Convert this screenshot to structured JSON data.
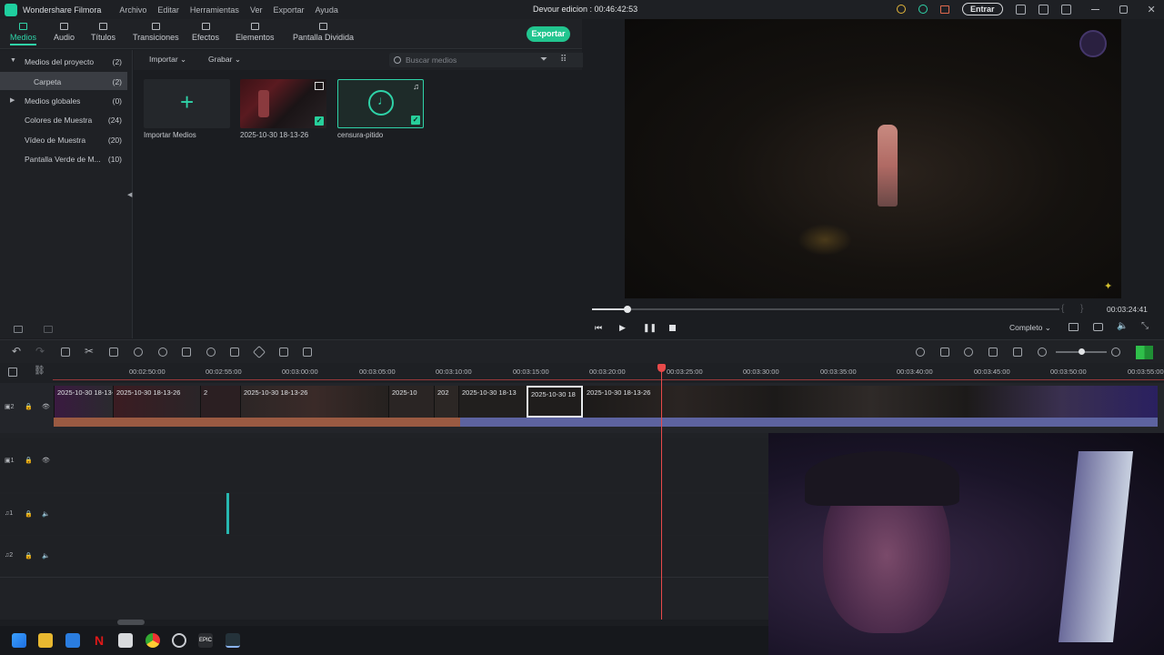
{
  "app": {
    "name": "Wondershare Filmora",
    "menu": [
      "Archivo",
      "Editar",
      "Herramientas",
      "Ver",
      "Exportar",
      "Ayuda"
    ],
    "project_title": "Devour edicion : 00:46:42:53",
    "login_label": "Entrar"
  },
  "tabs": [
    {
      "label": "Medios",
      "active": true
    },
    {
      "label": "Audio",
      "active": false
    },
    {
      "label": "Títulos",
      "active": false
    },
    {
      "label": "Transiciones",
      "active": false
    },
    {
      "label": "Efectos",
      "active": false
    },
    {
      "label": "Elementos",
      "active": false
    },
    {
      "label": "Pantalla Dividida",
      "active": false
    }
  ],
  "export_label": "Exportar",
  "sidebar": {
    "items": [
      {
        "label": "Medios del proyecto",
        "count": "(2)"
      },
      {
        "label": "Carpeta",
        "count": "(2)"
      },
      {
        "label": "Medios globales",
        "count": "(0)"
      },
      {
        "label": "Colores de Muestra",
        "count": "(24)"
      },
      {
        "label": "Vídeo de Muestra",
        "count": "(20)"
      },
      {
        "label": "Pantalla Verde de M...",
        "count": "(10)"
      }
    ]
  },
  "media_toolbar": {
    "import_label": "Importar",
    "record_label": "Grabar",
    "search_placeholder": "Buscar medios"
  },
  "media_items": [
    {
      "label": "Importar Medios"
    },
    {
      "label": "2025-10-30 18-13-26"
    },
    {
      "label": "censura-pitido"
    }
  ],
  "preview": {
    "timecode": "00:03:24:41",
    "quality": "Completo",
    "playback_progress": 0.08
  },
  "ruler_ticks": [
    "00:02:50:00",
    "00:02:55:00",
    "00:03:00:00",
    "00:03:05:00",
    "00:03:10:00",
    "00:03:15:00",
    "00:03:20:00",
    "00:03:25:00",
    "00:03:30:00",
    "00:03:35:00",
    "00:03:40:00",
    "00:03:45:00",
    "00:03:50:00",
    "00:03:55:00"
  ],
  "clips": [
    {
      "label": "2025-10-30 18-13-2"
    },
    {
      "label": "2025-10-30 18-13-26"
    },
    {
      "label": "2"
    },
    {
      "label": "2025-10-30 18-13-26"
    },
    {
      "label": "2025-10"
    },
    {
      "label": "202"
    },
    {
      "label": "2025-10-30 18-13"
    },
    {
      "label": "2025-10-30 18"
    },
    {
      "label": "2025-10-30 18-13-26"
    }
  ],
  "track_labels": {
    "v2": "2",
    "v1": "1",
    "a1": "1",
    "a2": "2"
  },
  "colors": {
    "accent": "#2fd3a8",
    "export": "#22c58f",
    "playhead": "#e84a4a"
  }
}
